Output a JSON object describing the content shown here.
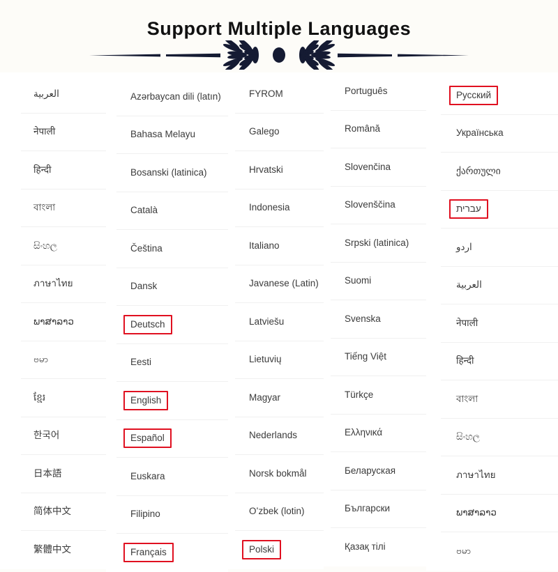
{
  "header": {
    "title": "Support Multiple Languages",
    "ornament_icon": "ornamental-divider-icon",
    "ornament_color": "#151b33"
  },
  "highlight_color": "#e01020",
  "columns": [
    {
      "name": "column-1",
      "items": [
        {
          "label": "العربية",
          "highlighted": false,
          "rtl": true
        },
        {
          "label": "नेपाली",
          "highlighted": false,
          "rtl": false
        },
        {
          "label": "हिन्दी",
          "highlighted": false,
          "rtl": false
        },
        {
          "label": "বাংলা",
          "highlighted": false,
          "rtl": false
        },
        {
          "label": "සිංහල",
          "highlighted": false,
          "rtl": false
        },
        {
          "label": "ภาษาไทย",
          "highlighted": false,
          "rtl": false
        },
        {
          "label": "ພາສາລາວ",
          "highlighted": false,
          "rtl": false
        },
        {
          "label": "ဗမာ",
          "highlighted": false,
          "rtl": false
        },
        {
          "label": "ខ្មែរ",
          "highlighted": false,
          "rtl": false
        },
        {
          "label": "한국어",
          "highlighted": false,
          "rtl": false
        },
        {
          "label": "日本語",
          "highlighted": false,
          "rtl": false
        },
        {
          "label": "简体中文",
          "highlighted": false,
          "rtl": false
        },
        {
          "label": "繁體中文",
          "highlighted": false,
          "rtl": false
        }
      ]
    },
    {
      "name": "column-2",
      "items": [
        {
          "label": "Azərbaycan dili (latın)",
          "highlighted": false,
          "rtl": false
        },
        {
          "label": "Bahasa Melayu",
          "highlighted": false,
          "rtl": false
        },
        {
          "label": "Bosanski (latinica)",
          "highlighted": false,
          "rtl": false
        },
        {
          "label": "Català",
          "highlighted": false,
          "rtl": false
        },
        {
          "label": "Čeština",
          "highlighted": false,
          "rtl": false
        },
        {
          "label": "Dansk",
          "highlighted": false,
          "rtl": false
        },
        {
          "label": "Deutsch",
          "highlighted": true,
          "rtl": false
        },
        {
          "label": "Eesti",
          "highlighted": false,
          "rtl": false
        },
        {
          "label": "English",
          "highlighted": true,
          "rtl": false
        },
        {
          "label": "Español",
          "highlighted": true,
          "rtl": false
        },
        {
          "label": "Euskara",
          "highlighted": false,
          "rtl": false
        },
        {
          "label": "Filipino",
          "highlighted": false,
          "rtl": false
        },
        {
          "label": "Français",
          "highlighted": true,
          "rtl": false
        }
      ]
    },
    {
      "name": "column-3",
      "items": [
        {
          "label": "FYROM",
          "highlighted": false,
          "rtl": false
        },
        {
          "label": "Galego",
          "highlighted": false,
          "rtl": false
        },
        {
          "label": "Hrvatski",
          "highlighted": false,
          "rtl": false
        },
        {
          "label": "Indonesia",
          "highlighted": false,
          "rtl": false
        },
        {
          "label": "Italiano",
          "highlighted": false,
          "rtl": false
        },
        {
          "label": "Javanese (Latin)",
          "highlighted": false,
          "rtl": false
        },
        {
          "label": "Latviešu",
          "highlighted": false,
          "rtl": false
        },
        {
          "label": "Lietuvių",
          "highlighted": false,
          "rtl": false
        },
        {
          "label": "Magyar",
          "highlighted": false,
          "rtl": false
        },
        {
          "label": "Nederlands",
          "highlighted": false,
          "rtl": false
        },
        {
          "label": "Norsk bokmål",
          "highlighted": false,
          "rtl": false
        },
        {
          "label": "Oʻzbek (lotin)",
          "highlighted": false,
          "rtl": false
        },
        {
          "label": "Polski",
          "highlighted": true,
          "rtl": false
        }
      ]
    },
    {
      "name": "column-4",
      "items": [
        {
          "label": "Português",
          "highlighted": false,
          "rtl": false
        },
        {
          "label": "Română",
          "highlighted": false,
          "rtl": false
        },
        {
          "label": "Slovenčina",
          "highlighted": false,
          "rtl": false
        },
        {
          "label": "Slovenščina",
          "highlighted": false,
          "rtl": false
        },
        {
          "label": "Srpski (latinica)",
          "highlighted": false,
          "rtl": false
        },
        {
          "label": "Suomi",
          "highlighted": false,
          "rtl": false
        },
        {
          "label": "Svenska",
          "highlighted": false,
          "rtl": false
        },
        {
          "label": "Tiếng Việt",
          "highlighted": false,
          "rtl": false
        },
        {
          "label": "Türkçe",
          "highlighted": false,
          "rtl": false
        },
        {
          "label": "Ελληνικά",
          "highlighted": false,
          "rtl": false
        },
        {
          "label": "Беларуская",
          "highlighted": false,
          "rtl": false
        },
        {
          "label": "Български",
          "highlighted": false,
          "rtl": false
        },
        {
          "label": "Қазақ тілі",
          "highlighted": false,
          "rtl": false
        }
      ]
    },
    {
      "name": "column-5",
      "items": [
        {
          "label": "Русский",
          "highlighted": true,
          "rtl": false
        },
        {
          "label": "Українська",
          "highlighted": false,
          "rtl": false
        },
        {
          "label": "ქართული",
          "highlighted": false,
          "rtl": false
        },
        {
          "label": "עברית",
          "highlighted": true,
          "rtl": true
        },
        {
          "label": "اردو",
          "highlighted": false,
          "rtl": true
        },
        {
          "label": "العربية",
          "highlighted": false,
          "rtl": true
        },
        {
          "label": "नेपाली",
          "highlighted": false,
          "rtl": false
        },
        {
          "label": "हिन्दी",
          "highlighted": false,
          "rtl": false
        },
        {
          "label": "বাংলা",
          "highlighted": false,
          "rtl": false
        },
        {
          "label": "සිංහල",
          "highlighted": false,
          "rtl": false
        },
        {
          "label": "ภาษาไทย",
          "highlighted": false,
          "rtl": false
        },
        {
          "label": "ພາສາລາວ",
          "highlighted": false,
          "rtl": false
        },
        {
          "label": "ဗမာ",
          "highlighted": false,
          "rtl": false
        }
      ]
    }
  ]
}
